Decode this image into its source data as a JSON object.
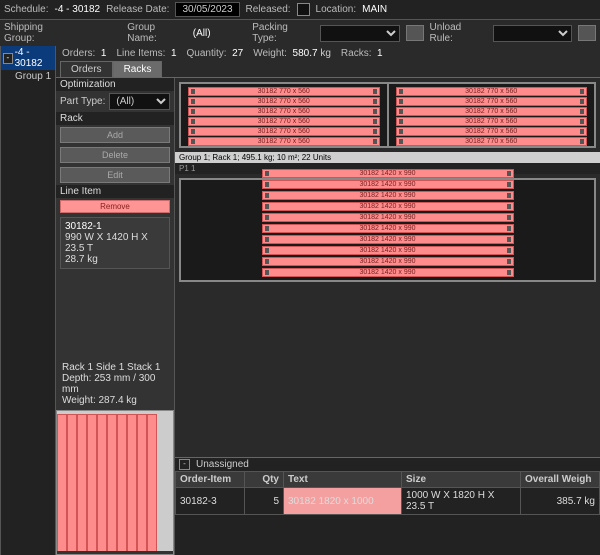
{
  "header": {
    "schedule_label": "Schedule:",
    "schedule_value": "-4 - 30182",
    "release_date_label": "Release Date:",
    "release_date_value": "30/05/2023",
    "released_label": "Released:",
    "location_label": "Location:",
    "location_value": "MAIN"
  },
  "header2": {
    "shipping_group_label": "Shipping Group:",
    "group_name_label": "Group Name:",
    "group_name_value": "(All)",
    "packing_type_label": "Packing Type:",
    "unload_rule_label": "Unload Rule:"
  },
  "tree": {
    "root": "-4 - 30182",
    "child": "Group 1"
  },
  "summary": {
    "orders_label": "Orders:",
    "orders_value": "1",
    "line_items_label": "Line Items:",
    "line_items_value": "1",
    "quantity_label": "Quantity:",
    "quantity_value": "27",
    "weight_label": "Weight:",
    "weight_value": "580.7",
    "weight_unit": "kg",
    "racks_label": "Racks:",
    "racks_value": "1"
  },
  "tabs": {
    "orders": "Orders",
    "racks": "Racks"
  },
  "opt": {
    "head": "Optimization",
    "part_type_label": "Part Type:",
    "part_type_value": "(All)"
  },
  "rack_panel": {
    "head": "Rack",
    "add": "Add",
    "delete": "Delete",
    "edit": "Edit"
  },
  "li_panel": {
    "head": "Line Item",
    "remove": "Remove",
    "id": "30182-1",
    "dims": "990 W X 1420 H X 23.5 T",
    "weight": "28.7 kg"
  },
  "rack_top": {
    "label": "30182 770 x 560",
    "count": 6,
    "status": "Group 1; Rack 1; 495.1 kg; 10 m²; 22 Units"
  },
  "rack_bottom": {
    "head": "P1 1",
    "label": "30182 1420 x 990",
    "count": 10
  },
  "side": {
    "title": "Rack 1 Side 1 Stack 1",
    "depth": "Depth:  253 mm  /  300 mm",
    "weight": "Weight:  287.4 kg",
    "bars": 10
  },
  "unassigned": {
    "head": "Unassigned",
    "col_order": "Order-Item",
    "col_qty": "Qty",
    "col_text": "Text",
    "col_size": "Size",
    "col_weight": "Overall Weigh",
    "rows": [
      {
        "order": "30182-3",
        "qty": "5",
        "text": "30182 1820 x 1000",
        "size": "1000 W X 1820 H X 23.5 T",
        "weight": "385.7 kg"
      }
    ]
  }
}
